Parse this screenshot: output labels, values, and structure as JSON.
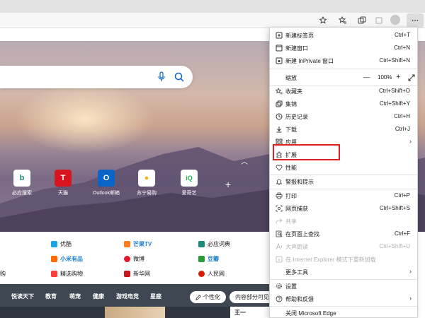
{
  "menu": {
    "items": [
      {
        "id": "new-tab",
        "label": "新建标签页",
        "shortcut": "Ctrl+T"
      },
      {
        "id": "new-window",
        "label": "新建窗口",
        "shortcut": "Ctrl+N"
      },
      {
        "id": "new-inprivate",
        "label": "新建 InPrivate 窗口",
        "shortcut": "Ctrl+Shift+N"
      },
      {
        "id": "zoom",
        "label": "缩放",
        "value": "100%",
        "minus": "—",
        "plus": "+"
      },
      {
        "id": "favorites",
        "label": "收藏夹",
        "shortcut": "Ctrl+Shift+O"
      },
      {
        "id": "collections",
        "label": "集锦",
        "shortcut": "Ctrl+Shift+Y"
      },
      {
        "id": "history",
        "label": "历史记录",
        "shortcut": "Ctrl+H"
      },
      {
        "id": "downloads",
        "label": "下载",
        "shortcut": "Ctrl+J"
      },
      {
        "id": "apps",
        "label": "应用"
      },
      {
        "id": "extensions",
        "label": "扩展"
      },
      {
        "id": "performance",
        "label": "性能"
      },
      {
        "id": "alerts",
        "label": "警报和提示"
      },
      {
        "id": "print",
        "label": "打印",
        "shortcut": "Ctrl+P"
      },
      {
        "id": "web-capture",
        "label": "网页捕获",
        "shortcut": "Ctrl+Shift+S"
      },
      {
        "id": "share",
        "label": "共享"
      },
      {
        "id": "find",
        "label": "在页面上查找",
        "shortcut": "Ctrl+F"
      },
      {
        "id": "read-aloud",
        "label": "大声朗读",
        "shortcut": "Ctrl+Shift+U"
      },
      {
        "id": "ie-mode",
        "label": "在 Internet Explorer 模式下重新加载"
      },
      {
        "id": "more-tools",
        "label": "更多工具"
      },
      {
        "id": "settings",
        "label": "设置"
      },
      {
        "id": "help",
        "label": "帮助和反馈"
      },
      {
        "id": "close",
        "label": "关闭 Microsoft Edge"
      }
    ]
  },
  "quick_links": [
    {
      "label": "必应搜索",
      "glyph": "b",
      "color": "#1a8a7a"
    },
    {
      "label": "天猫",
      "glyph": "T",
      "color": "#d8141e"
    },
    {
      "label": "Outlook邮箱",
      "glyph": "O",
      "color": "#0a64c8"
    },
    {
      "label": "苏宁易购",
      "glyph": "●",
      "color": "#f2b51a"
    },
    {
      "label": "爱奇艺",
      "glyph": "iQ",
      "color": "#20b34a"
    }
  ],
  "site_links": {
    "row1": [
      "优酷",
      "芒果TV",
      "必应词典"
    ],
    "row2": [
      "小米有品",
      "微博",
      "豆瓣"
    ],
    "row3_left": "购",
    "row3": [
      "精选购物",
      "新华网",
      "人民网"
    ]
  },
  "news": {
    "tabs": [
      "悦读天下",
      "教育",
      "萌宠",
      "健康",
      "游戏电竞",
      "星座"
    ],
    "personalize": "个性化",
    "partial": "内容部分可见",
    "thumb_caption": "王一"
  },
  "colors": {
    "highlight": "#e02020",
    "accent": "#0a64c8"
  }
}
